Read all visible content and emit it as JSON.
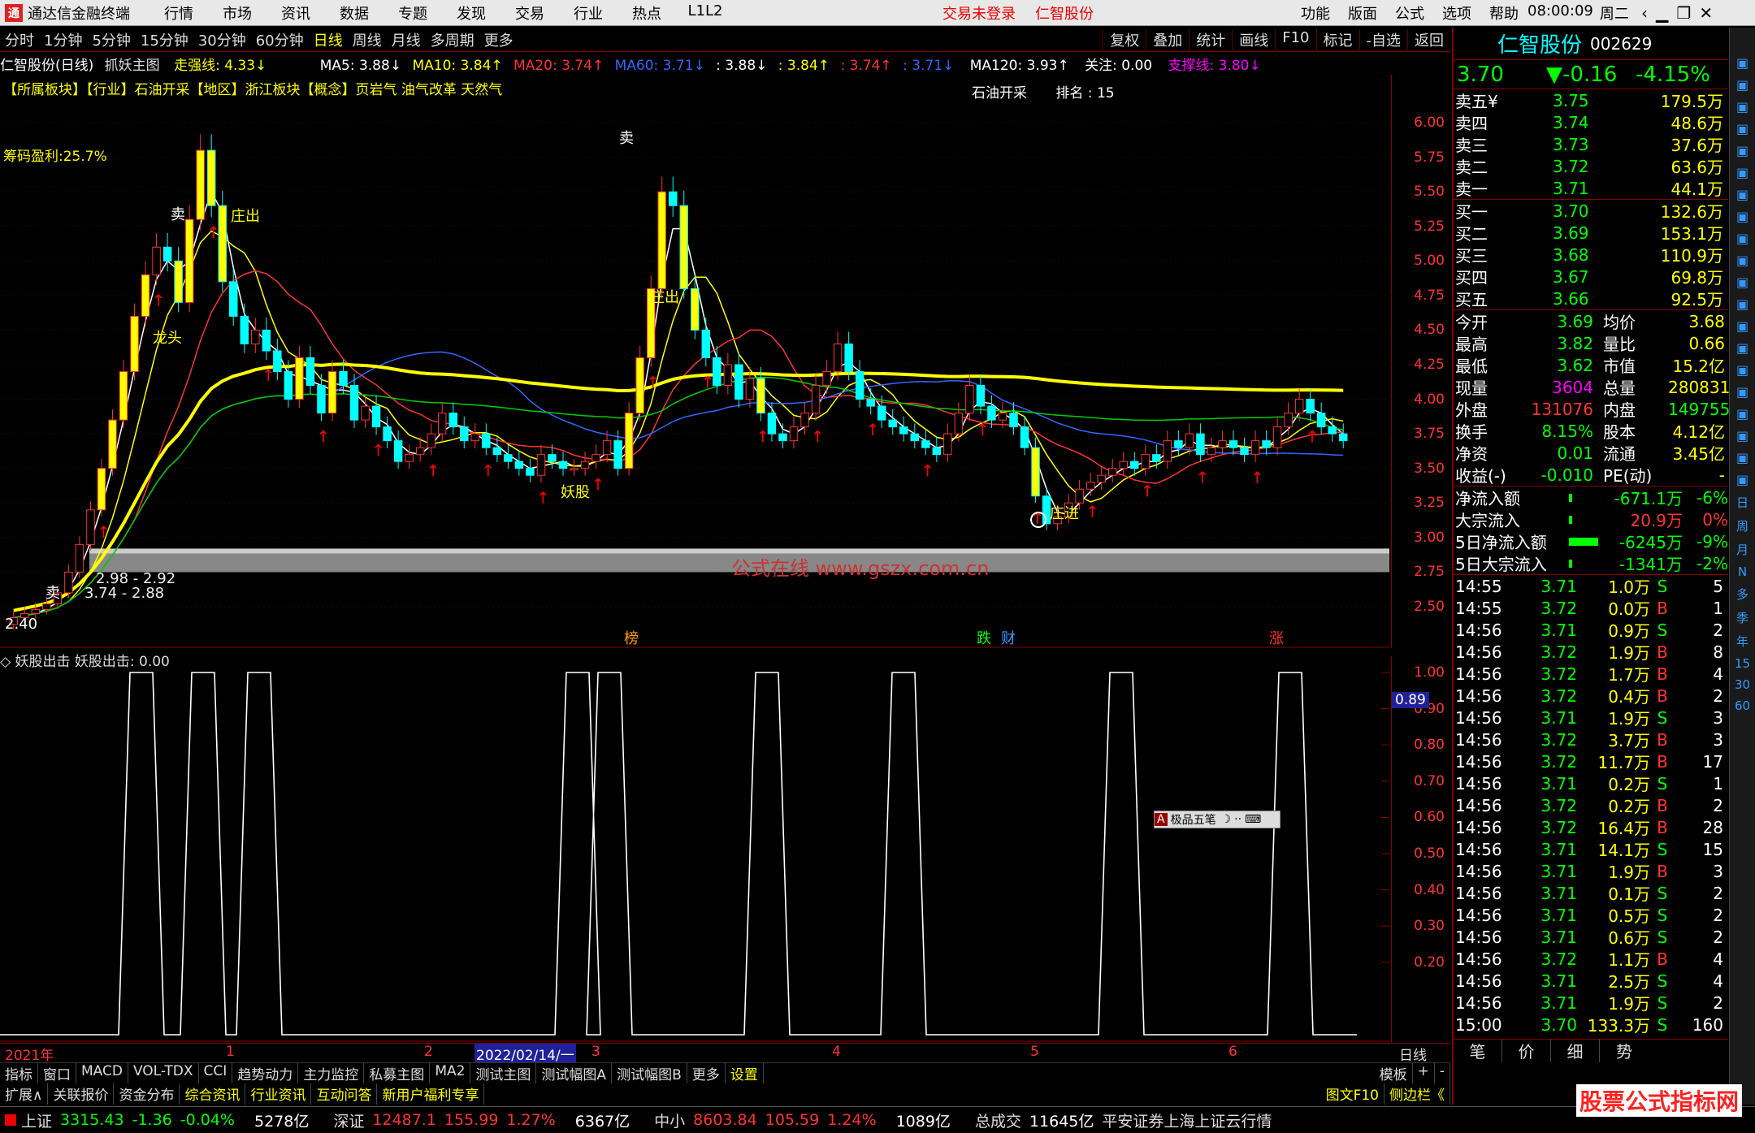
{
  "titlebar": {
    "app": "通达信金融终端",
    "menu": [
      "行情",
      "市场",
      "资讯",
      "数据",
      "专题",
      "发现",
      "交易",
      "行业",
      "热点",
      "L1L2"
    ],
    "login": "交易未登录",
    "stock": "仁智股份",
    "right": [
      "功能",
      "版面",
      "公式",
      "选项",
      "帮助"
    ],
    "time": "08:00:09",
    "weekday": "周二"
  },
  "toolbar": {
    "periods": [
      "分时",
      "1分钟",
      "5分钟",
      "15分钟",
      "30分钟",
      "60分钟",
      "日线",
      "周线",
      "月线",
      "多周期",
      "更多"
    ],
    "active": "日线",
    "rbtns": [
      "复权",
      "叠加",
      "统计",
      "画线",
      "F10",
      "标记",
      "-自选",
      "返回"
    ]
  },
  "chartinfo": {
    "name": "仁智股份(日线)",
    "main": "抓妖主图",
    "strong": "走强线: 4.33↓",
    "ma5": "MA5: 3.88↓",
    "ma10": "MA10: 3.84↑",
    "ma20": "MA20: 3.74↑",
    "ma60": "MA60: 3.71↓",
    "v1": ": 3.88↓",
    "v2": ": 3.84↑",
    "v3": ": 3.74↑",
    "v4": ": 3.71↓",
    "ma120": "MA120: 3.93↑",
    "guanzhu": "关注: 0.00",
    "support": "支撑线: 3.80↓"
  },
  "sectors": "【所属板块】【行业】石油开采【地区】浙江板块【概念】页岩气 油气改革 天然气",
  "sector_right": {
    "name": "石油开采",
    "rank": "排名 : 15"
  },
  "chip": "筹码盈利:25.7%",
  "main_labels": {
    "sell1": "卖",
    "sell2": "卖",
    "sell3": "卖",
    "zhuangchu1": "庄出",
    "zhuangchu2": "庄出",
    "longtou": "龙头",
    "yaogu": "妖股",
    "zhuangjin": "庄进",
    "band1": "2.98 - 2.92",
    "band2": "3.74 - 2.88",
    "low": "2.40",
    "bang": "榜",
    "die": "跌",
    "cai": "财",
    "zhang": "涨"
  },
  "yaxis_main": [
    "6.00",
    "5.75",
    "5.50",
    "5.25",
    "5.00",
    "4.75",
    "4.50",
    "4.25",
    "4.00",
    "3.75",
    "3.50",
    "3.25",
    "3.00",
    "2.75",
    "2.50"
  ],
  "indicator": {
    "name": "妖股出击",
    "value": "妖股出击: 0.00",
    "current": "0.89"
  },
  "yaxis_sub": [
    "1.00",
    "0.90",
    "0.80",
    "0.70",
    "0.60",
    "0.50",
    "0.40",
    "0.30",
    "0.20"
  ],
  "xaxis": {
    "year": "2021年",
    "m1": "1",
    "m2": "2",
    "cursor": "2022/02/14/一",
    "m3": "3",
    "m4": "4",
    "m5": "5",
    "m6": "6",
    "period": "日线"
  },
  "tabs": [
    "指标",
    "窗口",
    "MACD",
    "VOL-TDX",
    "CCI",
    "趋势动力",
    "主力监控",
    "私募主图",
    "MA2",
    "测试主图",
    "测试幅图A",
    "测试幅图B",
    "更多",
    "设置"
  ],
  "tabs_right": [
    "模板",
    "+",
    "-"
  ],
  "tabs2": [
    "扩展∧",
    "关联报价",
    "资金分布",
    "综合资讯",
    "行业资讯",
    "互动问答",
    "新用户福利专享"
  ],
  "tabs2_right": [
    "图文F10",
    "侧边栏《",
    "笔",
    "价",
    "细",
    "势"
  ],
  "quote": {
    "name": "仁智股份",
    "code": "002629",
    "price": "3.70",
    "change": "▼-0.16",
    "pct": "-4.15%",
    "asks": [
      [
        "卖五¥",
        "3.75",
        "179.5万"
      ],
      [
        "卖四",
        "3.74",
        "48.6万"
      ],
      [
        "卖三",
        "3.73",
        "37.6万"
      ],
      [
        "卖二",
        "3.72",
        "63.6万"
      ],
      [
        "卖一",
        "3.71",
        "44.1万"
      ]
    ],
    "bids": [
      [
        "买一",
        "3.70",
        "132.6万"
      ],
      [
        "买二",
        "3.69",
        "153.1万"
      ],
      [
        "买三",
        "3.68",
        "110.9万"
      ],
      [
        "买四",
        "3.67",
        "69.8万"
      ],
      [
        "买五",
        "3.66",
        "92.5万"
      ]
    ],
    "stats": [
      [
        "今开",
        "3.69",
        "均价",
        "3.68"
      ],
      [
        "最高",
        "3.82",
        "量比",
        "0.66"
      ],
      [
        "最低",
        "3.62",
        "市值",
        "15.2亿"
      ],
      [
        "现量",
        "3604",
        "总量",
        "280831"
      ],
      [
        "外盘",
        "131076",
        "内盘",
        "149755"
      ],
      [
        "换手",
        "8.15%",
        "股本",
        "4.12亿"
      ],
      [
        "净资",
        "0.01",
        "流通",
        "3.45亿"
      ],
      [
        "收益(-)",
        "-0.010",
        "PE(动)",
        "-"
      ]
    ],
    "flows": [
      [
        "净流入额",
        "-671.1万",
        "-6%"
      ],
      [
        "大宗流入",
        "20.9万",
        "0%"
      ],
      [
        "5日净流入额",
        "-6245万",
        "-9%"
      ],
      [
        "5日大宗流入",
        "-1341万",
        "-2%"
      ]
    ],
    "ticks": [
      [
        "14:55",
        "3.71",
        "1.0万",
        "S",
        "5"
      ],
      [
        "14:55",
        "3.72",
        "0.0万",
        "B",
        "1"
      ],
      [
        "14:56",
        "3.71",
        "0.9万",
        "S",
        "2"
      ],
      [
        "14:56",
        "3.72",
        "1.9万",
        "B",
        "8"
      ],
      [
        "14:56",
        "3.72",
        "1.7万",
        "B",
        "4"
      ],
      [
        "14:56",
        "3.72",
        "0.4万",
        "B",
        "2"
      ],
      [
        "14:56",
        "3.71",
        "1.9万",
        "S",
        "3"
      ],
      [
        "14:56",
        "3.72",
        "3.7万",
        "B",
        "3"
      ],
      [
        "14:56",
        "3.72",
        "11.7万",
        "B",
        "17"
      ],
      [
        "14:56",
        "3.71",
        "0.2万",
        "S",
        "1"
      ],
      [
        "14:56",
        "3.72",
        "0.2万",
        "B",
        "2"
      ],
      [
        "14:56",
        "3.72",
        "16.4万",
        "B",
        "28"
      ],
      [
        "14:56",
        "3.71",
        "14.1万",
        "S",
        "15"
      ],
      [
        "14:56",
        "3.71",
        "1.9万",
        "B",
        "3"
      ],
      [
        "14:56",
        "3.71",
        "0.1万",
        "S",
        "2"
      ],
      [
        "14:56",
        "3.71",
        "0.5万",
        "S",
        "2"
      ],
      [
        "14:56",
        "3.71",
        "0.6万",
        "S",
        "2"
      ],
      [
        "14:56",
        "3.72",
        "1.1万",
        "B",
        "4"
      ],
      [
        "14:56",
        "3.71",
        "2.5万",
        "S",
        "4"
      ],
      [
        "14:56",
        "3.71",
        "1.9万",
        "S",
        "2"
      ],
      [
        "15:00",
        "3.70",
        "133.3万",
        "S",
        "160"
      ]
    ]
  },
  "sidestrip": [
    "日",
    "周",
    "月",
    "N",
    "多",
    "季",
    "年",
    "15",
    "30",
    "60"
  ],
  "status": {
    "sh": "上证",
    "sh_v": "3315.43",
    "sh_c": "-1.36",
    "sh_p": "-0.04%",
    "sh_a": "5278亿",
    "sz": "深证",
    "sz_v": "12487.1",
    "sz_c": "155.99",
    "sz_p": "1.27%",
    "sz_a": "6367亿",
    "zx": "中小",
    "zx_v": "8603.84",
    "zx_c": "105.59",
    "zx_p": "1.24%",
    "zx_a": "1089亿",
    "tot": "总成交",
    "tot_v": "11645亿",
    "msg": "平安证券上海上证云行情"
  },
  "ime": "极品五笔",
  "watermark1": "公式在线 www.gszx.com.cn",
  "watermark2": "股票公式指标网",
  "chart_data": {
    "type": "candlestick",
    "closes": [
      2.42,
      2.45,
      2.48,
      2.52,
      2.6,
      2.75,
      2.95,
      3.2,
      3.5,
      3.85,
      4.2,
      4.6,
      4.9,
      5.1,
      5.0,
      4.7,
      5.3,
      5.8,
      5.4,
      4.85,
      4.6,
      4.4,
      4.5,
      4.35,
      4.2,
      4.0,
      4.3,
      4.1,
      3.9,
      4.2,
      4.1,
      3.85,
      3.95,
      3.8,
      3.7,
      3.55,
      3.6,
      3.65,
      3.75,
      3.9,
      3.8,
      3.7,
      3.75,
      3.65,
      3.6,
      3.55,
      3.5,
      3.45,
      3.6,
      3.55,
      3.5,
      3.5,
      3.55,
      3.6,
      3.7,
      3.5,
      3.9,
      4.3,
      4.8,
      5.5,
      5.4,
      4.8,
      4.5,
      4.3,
      4.1,
      4.25,
      4.0,
      4.15,
      3.9,
      3.75,
      3.7,
      3.8,
      3.9,
      4.1,
      4.2,
      4.4,
      4.2,
      4.0,
      3.95,
      3.85,
      3.8,
      3.75,
      3.7,
      3.65,
      3.6,
      3.75,
      3.9,
      4.1,
      3.95,
      3.85,
      3.9,
      3.8,
      3.65,
      3.3,
      3.1,
      3.15,
      3.25,
      3.35,
      3.4,
      3.45,
      3.5,
      3.55,
      3.5,
      3.6,
      3.55,
      3.7,
      3.65,
      3.75,
      3.6,
      3.65,
      3.7,
      3.65,
      3.6,
      3.7,
      3.65,
      3.8,
      3.9,
      4.0,
      3.9,
      3.8,
      3.75,
      3.7
    ],
    "ylim": [
      2.4,
      6.1
    ],
    "indicator_peaks": [
      0.155,
      0.23,
      0.28,
      0.62,
      0.665,
      0.83,
      1.0,
      1.25,
      1.45
    ],
    "indicator_ylim": [
      0,
      1
    ]
  }
}
